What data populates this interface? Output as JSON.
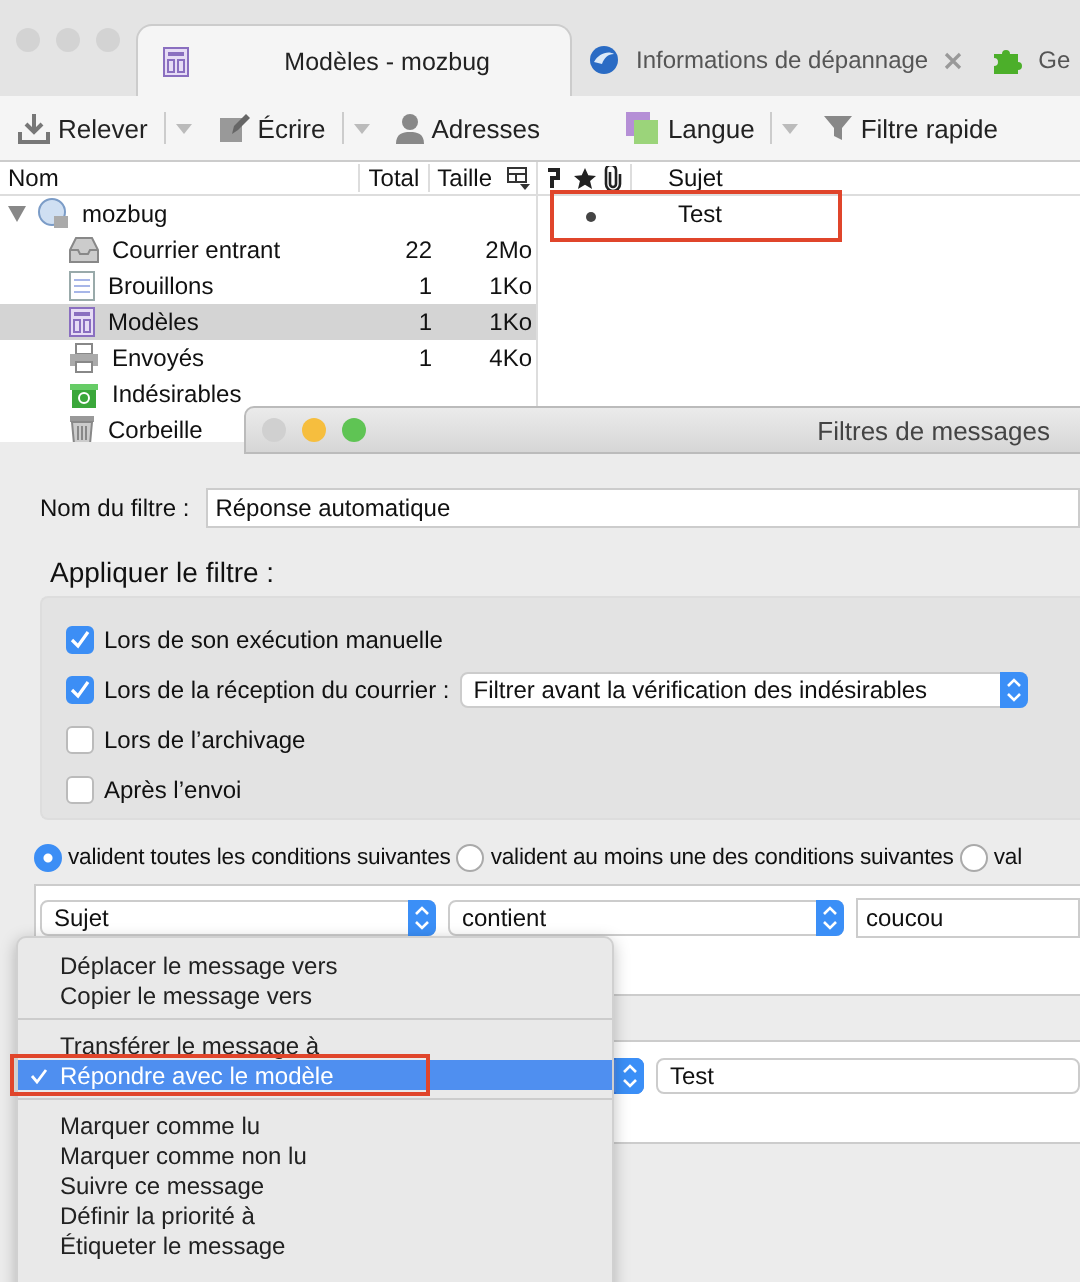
{
  "tabs": [
    {
      "label": "Modèles - mozbug",
      "selected": true,
      "closable": false
    },
    {
      "label": "Informations de dépannage",
      "selected": false,
      "closable": true
    },
    {
      "label": "Ge",
      "selected": false,
      "closable": false
    }
  ],
  "toolbar": [
    {
      "label": "Relever",
      "dropdown": true
    },
    {
      "label": "Écrire",
      "dropdown": true
    },
    {
      "label": "Adresses",
      "dropdown": false
    },
    {
      "label": "Langue",
      "dropdown": true
    },
    {
      "label": "Filtre rapide",
      "dropdown": false
    }
  ],
  "folder_pane": {
    "columns": [
      "Nom",
      "Total",
      "Taille"
    ],
    "account": {
      "name": "mozbug",
      "expanded": true,
      "children": [
        {
          "name": "Courrier entrant",
          "total": "22",
          "size": "2Mo",
          "selected": false
        },
        {
          "name": "Brouillons",
          "total": "1",
          "size": "1Ko",
          "selected": false
        },
        {
          "name": "Modèles",
          "total": "1",
          "size": "1Ko",
          "selected": true
        },
        {
          "name": "Envoyés",
          "total": "1",
          "size": "4Ko",
          "selected": false
        },
        {
          "name": "Indésirables",
          "selected": false
        },
        {
          "name": "Corbeille",
          "selected": false
        }
      ]
    }
  },
  "message_list": {
    "columns": [
      "Sujet"
    ],
    "rows": [
      {
        "subject": "Test",
        "unread": true,
        "annotated": true
      }
    ]
  },
  "dialog": {
    "title": "Filtres de messages",
    "filter_name": {
      "label": "Nom du filtre :",
      "value": "Réponse automatique"
    },
    "apply": {
      "heading": "Appliquer le filtre :",
      "options": [
        {
          "label": "Lors de son exécution manuelle",
          "checked": true
        },
        {
          "label": "Lors de la réception du courrier :",
          "checked": true,
          "select": "Filtrer avant la vérification des indésirables"
        },
        {
          "label": "Lors de l’archivage",
          "checked": false
        },
        {
          "label": "Après l’envoi",
          "checked": false
        }
      ]
    },
    "match": [
      {
        "label": "valident toutes les conditions suivantes",
        "selected": true
      },
      {
        "label": "valident au moins une des conditions suivantes",
        "selected": false
      },
      {
        "label": "val",
        "selected": false
      }
    ],
    "conditions": [
      {
        "field": "Sujet",
        "operator": "contient",
        "value": "coucou"
      }
    ],
    "actions": [
      {
        "value": "Test"
      }
    ]
  },
  "action_menu": {
    "groups": [
      [
        {
          "label": "Déplacer le message vers",
          "selected": false
        },
        {
          "label": "Copier le message vers",
          "selected": false
        }
      ],
      [
        {
          "label": "Transférer le message à",
          "selected": false
        },
        {
          "label": "Répondre avec le modèle",
          "selected": true,
          "annotated": true
        }
      ],
      [
        {
          "label": "Marquer comme lu",
          "selected": false
        },
        {
          "label": "Marquer comme non lu",
          "selected": false
        },
        {
          "label": "Suivre ce message",
          "selected": false
        },
        {
          "label": "Définir la priorité à",
          "selected": false
        },
        {
          "label": "Étiqueter le message",
          "selected": false
        }
      ]
    ]
  }
}
